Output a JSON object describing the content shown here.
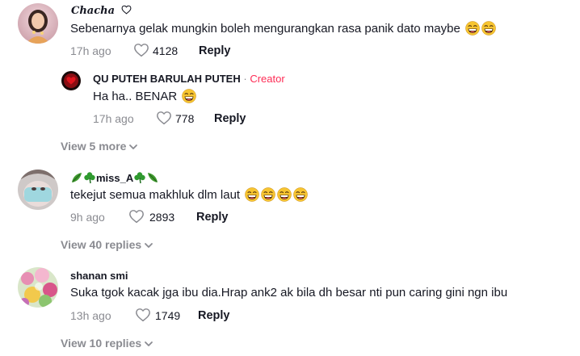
{
  "comments": [
    {
      "username": "Chacha",
      "text": "Sebenarnya gelak mungkin boleh mengurangkan rasa panik dato maybe",
      "time": "17h ago",
      "likes": "4128",
      "reply_label": "Reply"
    },
    {
      "username": "QU PUTEH BARULAH PUTEH",
      "separator": "·",
      "badge": "Creator",
      "text": "Ha ha.. BENAR",
      "time": "17h ago",
      "likes": "778",
      "reply_label": "Reply",
      "view_more": "View 5 more"
    },
    {
      "username": "miss_A",
      "text": "tekejut semua makhluk dlm laut",
      "time": "9h ago",
      "likes": "2893",
      "reply_label": "Reply",
      "view_replies": "View 40 replies"
    },
    {
      "username": "shanan smi",
      "text": "Suka tgok kacak jga ibu dia.Hrap ank2 ak bila dh besar nti pun caring gini ngn ibu",
      "time": "13h ago",
      "likes": "1749",
      "reply_label": "Reply",
      "view_replies": "View 10 replies"
    }
  ],
  "icons": {
    "like": "heart-outline-icon",
    "expand": "chevron-down-icon",
    "emoji": "laughing-emoji-icon"
  },
  "colors": {
    "text": "#161823",
    "secondary": "#8a8b91",
    "creator_badge": "#fe2c55",
    "emoji_face": "#f7c531"
  }
}
